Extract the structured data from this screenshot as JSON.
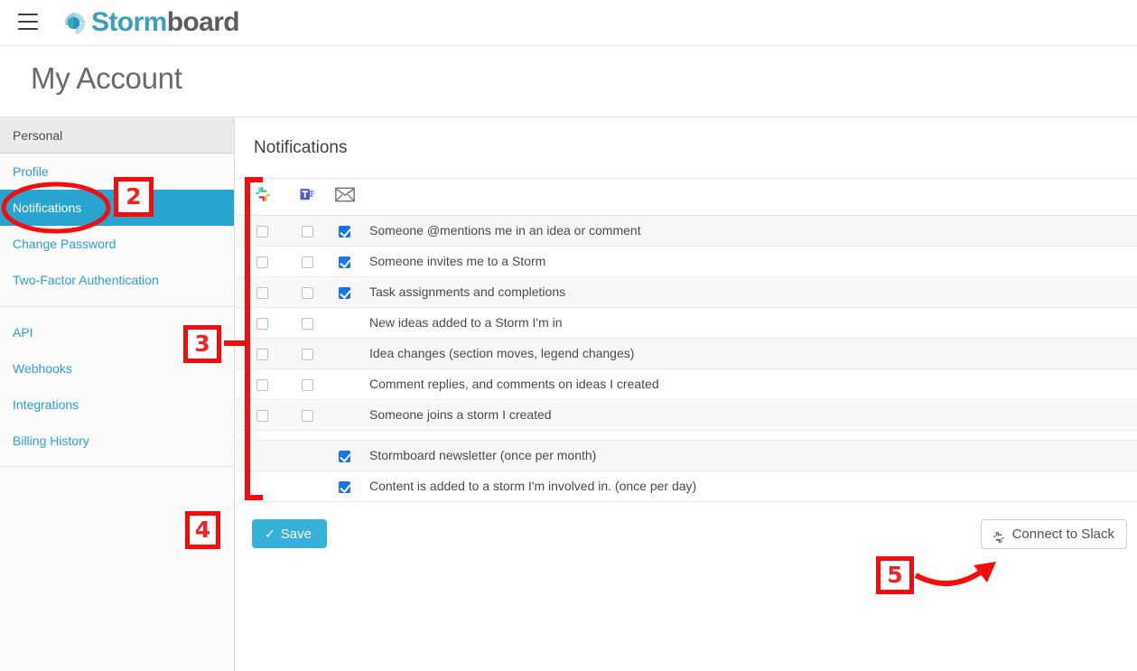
{
  "brand": {
    "name_part1": "Storm",
    "name_part2": "board",
    "accent": "#3aa0bd",
    "dark": "#5d5d5d",
    "logo_icon": "stormboard-pinwheel-icon",
    "menu_icon": "hamburger-menu-icon"
  },
  "page": {
    "title": "My Account"
  },
  "sidebar": {
    "group_label": "Personal",
    "items": [
      {
        "label": "Profile",
        "active": false
      },
      {
        "label": "Notifications",
        "active": true
      },
      {
        "label": "Change Password",
        "active": false
      },
      {
        "label": "Two-Factor Authentication",
        "active": false
      }
    ],
    "items2": [
      {
        "label": "API",
        "active": false
      },
      {
        "label": "Webhooks",
        "active": false
      },
      {
        "label": "Integrations",
        "active": false
      },
      {
        "label": "Billing History",
        "active": false
      }
    ],
    "active_bg": "#29a3cf",
    "link_color": "#2b9fd4"
  },
  "main": {
    "section_title": "Notifications",
    "columns": [
      {
        "icon": "slack-icon",
        "label": "Slack"
      },
      {
        "icon": "microsoft-teams-icon",
        "label": "Microsoft Teams"
      },
      {
        "icon": "email-envelope-icon",
        "label": "Email"
      },
      {
        "icon": "",
        "label": ""
      }
    ],
    "rows": [
      {
        "label": "Someone @mentions me in an idea or comment",
        "slack": "off",
        "teams": "off",
        "email": "on"
      },
      {
        "label": "Someone invites me to a Storm",
        "slack": "off",
        "teams": "off",
        "email": "on"
      },
      {
        "label": "Task assignments and completions",
        "slack": "off",
        "teams": "off",
        "email": "on"
      },
      {
        "label": "New ideas added to a Storm I'm in",
        "slack": "off",
        "teams": "off",
        "email": "none"
      },
      {
        "label": "Idea changes (section moves, legend changes)",
        "slack": "off",
        "teams": "off",
        "email": "none"
      },
      {
        "label": "Comment replies, and comments on ideas I created",
        "slack": "off",
        "teams": "off",
        "email": "none"
      },
      {
        "label": "Someone joins a storm I created",
        "slack": "off",
        "teams": "off",
        "email": "none"
      },
      {
        "label": "Stormboard newsletter (once per month)",
        "slack": "none",
        "teams": "none",
        "email": "on"
      },
      {
        "label": "Content is added to a storm I'm involved in. (once per day)",
        "slack": "none",
        "teams": "none",
        "email": "on"
      }
    ],
    "save_label": "Save",
    "save_icon": "check-icon",
    "save_color": "#36b0d9",
    "connect_slack_label": "Connect to Slack",
    "connect_slack_icon": "slack-icon"
  },
  "annotations": {
    "color": "#f50c0c",
    "markers": [
      {
        "id": "2",
        "target": "sidebar-item-notifications"
      },
      {
        "id": "3",
        "target": "notification-channel-columns"
      },
      {
        "id": "4",
        "target": "save-button"
      },
      {
        "id": "5",
        "target": "connect-to-slack-button"
      }
    ],
    "shapes": [
      "ellipse-around-notifications",
      "bracket-around-checkbox-columns",
      "curved-arrow-to-connect-slack"
    ]
  }
}
